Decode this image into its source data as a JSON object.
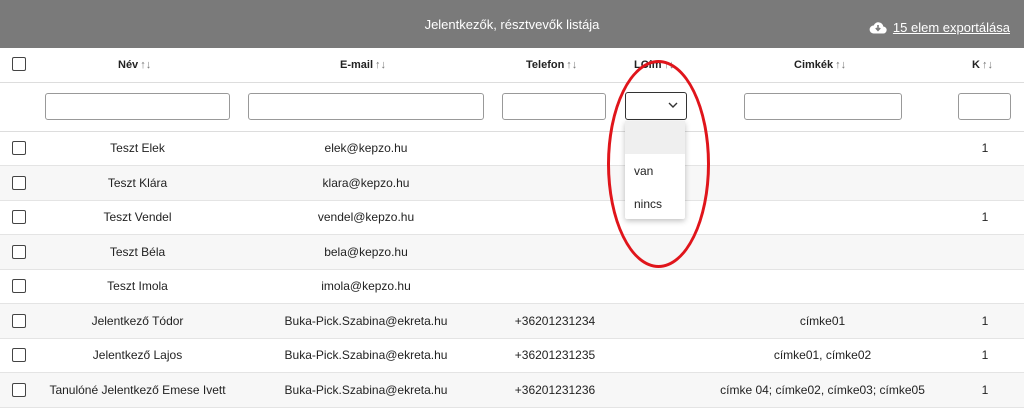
{
  "header": {
    "title": "Jelentkezők, résztvevők listája",
    "export_label": "15 elem exportálása"
  },
  "columns": [
    {
      "label": "Név",
      "sort": "↑↓"
    },
    {
      "label": "E-mail",
      "sort": "↑↓"
    },
    {
      "label": "Telefon",
      "sort": "↑↓"
    },
    {
      "label": "LCím",
      "sort": "↑↓"
    },
    {
      "label": "Cimkék",
      "sort": "↑↓"
    },
    {
      "label": "K",
      "sort": "↑↓"
    }
  ],
  "lcim_dropdown": {
    "options": [
      "",
      "van",
      "nincs"
    ]
  },
  "rows": [
    {
      "name": "Teszt Elek",
      "email": "elek@kepzo.hu",
      "phone": "",
      "tags": "",
      "k": "1"
    },
    {
      "name": "Teszt Klára",
      "email": "klara@kepzo.hu",
      "phone": "",
      "tags": "",
      "k": ""
    },
    {
      "name": "Teszt Vendel",
      "email": "vendel@kepzo.hu",
      "phone": "",
      "tags": "",
      "k": "1"
    },
    {
      "name": "Teszt Béla",
      "email": "bela@kepzo.hu",
      "phone": "",
      "tags": "",
      "k": ""
    },
    {
      "name": "Teszt Imola",
      "email": "imola@kepzo.hu",
      "phone": "",
      "tags": "",
      "k": ""
    },
    {
      "name": "Jelentkező Tódor",
      "email": "Buka-Pick.Szabina@ekreta.hu",
      "phone": "+36201231234",
      "tags": "címke01",
      "k": "1"
    },
    {
      "name": "Jelentkező Lajos",
      "email": "Buka-Pick.Szabina@ekreta.hu",
      "phone": "+36201231235",
      "tags": "címke01, címke02",
      "k": "1"
    },
    {
      "name": "Tanulóné Jelentkező Emese Ivett",
      "email": "Buka-Pick.Szabina@ekreta.hu",
      "phone": "+36201231236",
      "tags": "címke 04; címke02, címke03; címke05",
      "k": "1"
    }
  ],
  "colors": {
    "header_bg": "#7a7a7a",
    "annotation": "#e0151b"
  }
}
